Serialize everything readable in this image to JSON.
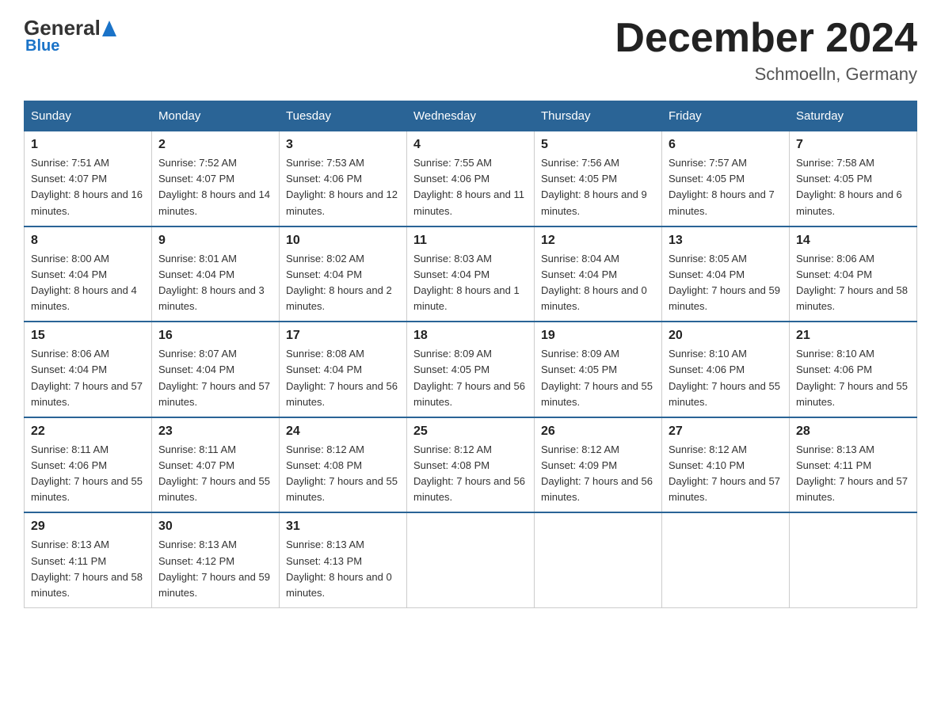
{
  "header": {
    "logo_general": "General",
    "logo_blue": "Blue",
    "month_title": "December 2024",
    "location": "Schmoelln, Germany"
  },
  "days_of_week": [
    "Sunday",
    "Monday",
    "Tuesday",
    "Wednesday",
    "Thursday",
    "Friday",
    "Saturday"
  ],
  "weeks": [
    [
      {
        "day": "1",
        "sunrise": "7:51 AM",
        "sunset": "4:07 PM",
        "daylight": "8 hours and 16 minutes."
      },
      {
        "day": "2",
        "sunrise": "7:52 AM",
        "sunset": "4:07 PM",
        "daylight": "8 hours and 14 minutes."
      },
      {
        "day": "3",
        "sunrise": "7:53 AM",
        "sunset": "4:06 PM",
        "daylight": "8 hours and 12 minutes."
      },
      {
        "day": "4",
        "sunrise": "7:55 AM",
        "sunset": "4:06 PM",
        "daylight": "8 hours and 11 minutes."
      },
      {
        "day": "5",
        "sunrise": "7:56 AM",
        "sunset": "4:05 PM",
        "daylight": "8 hours and 9 minutes."
      },
      {
        "day": "6",
        "sunrise": "7:57 AM",
        "sunset": "4:05 PM",
        "daylight": "8 hours and 7 minutes."
      },
      {
        "day": "7",
        "sunrise": "7:58 AM",
        "sunset": "4:05 PM",
        "daylight": "8 hours and 6 minutes."
      }
    ],
    [
      {
        "day": "8",
        "sunrise": "8:00 AM",
        "sunset": "4:04 PM",
        "daylight": "8 hours and 4 minutes."
      },
      {
        "day": "9",
        "sunrise": "8:01 AM",
        "sunset": "4:04 PM",
        "daylight": "8 hours and 3 minutes."
      },
      {
        "day": "10",
        "sunrise": "8:02 AM",
        "sunset": "4:04 PM",
        "daylight": "8 hours and 2 minutes."
      },
      {
        "day": "11",
        "sunrise": "8:03 AM",
        "sunset": "4:04 PM",
        "daylight": "8 hours and 1 minute."
      },
      {
        "day": "12",
        "sunrise": "8:04 AM",
        "sunset": "4:04 PM",
        "daylight": "8 hours and 0 minutes."
      },
      {
        "day": "13",
        "sunrise": "8:05 AM",
        "sunset": "4:04 PM",
        "daylight": "7 hours and 59 minutes."
      },
      {
        "day": "14",
        "sunrise": "8:06 AM",
        "sunset": "4:04 PM",
        "daylight": "7 hours and 58 minutes."
      }
    ],
    [
      {
        "day": "15",
        "sunrise": "8:06 AM",
        "sunset": "4:04 PM",
        "daylight": "7 hours and 57 minutes."
      },
      {
        "day": "16",
        "sunrise": "8:07 AM",
        "sunset": "4:04 PM",
        "daylight": "7 hours and 57 minutes."
      },
      {
        "day": "17",
        "sunrise": "8:08 AM",
        "sunset": "4:04 PM",
        "daylight": "7 hours and 56 minutes."
      },
      {
        "day": "18",
        "sunrise": "8:09 AM",
        "sunset": "4:05 PM",
        "daylight": "7 hours and 56 minutes."
      },
      {
        "day": "19",
        "sunrise": "8:09 AM",
        "sunset": "4:05 PM",
        "daylight": "7 hours and 55 minutes."
      },
      {
        "day": "20",
        "sunrise": "8:10 AM",
        "sunset": "4:06 PM",
        "daylight": "7 hours and 55 minutes."
      },
      {
        "day": "21",
        "sunrise": "8:10 AM",
        "sunset": "4:06 PM",
        "daylight": "7 hours and 55 minutes."
      }
    ],
    [
      {
        "day": "22",
        "sunrise": "8:11 AM",
        "sunset": "4:06 PM",
        "daylight": "7 hours and 55 minutes."
      },
      {
        "day": "23",
        "sunrise": "8:11 AM",
        "sunset": "4:07 PM",
        "daylight": "7 hours and 55 minutes."
      },
      {
        "day": "24",
        "sunrise": "8:12 AM",
        "sunset": "4:08 PM",
        "daylight": "7 hours and 55 minutes."
      },
      {
        "day": "25",
        "sunrise": "8:12 AM",
        "sunset": "4:08 PM",
        "daylight": "7 hours and 56 minutes."
      },
      {
        "day": "26",
        "sunrise": "8:12 AM",
        "sunset": "4:09 PM",
        "daylight": "7 hours and 56 minutes."
      },
      {
        "day": "27",
        "sunrise": "8:12 AM",
        "sunset": "4:10 PM",
        "daylight": "7 hours and 57 minutes."
      },
      {
        "day": "28",
        "sunrise": "8:13 AM",
        "sunset": "4:11 PM",
        "daylight": "7 hours and 57 minutes."
      }
    ],
    [
      {
        "day": "29",
        "sunrise": "8:13 AM",
        "sunset": "4:11 PM",
        "daylight": "7 hours and 58 minutes."
      },
      {
        "day": "30",
        "sunrise": "8:13 AM",
        "sunset": "4:12 PM",
        "daylight": "7 hours and 59 minutes."
      },
      {
        "day": "31",
        "sunrise": "8:13 AM",
        "sunset": "4:13 PM",
        "daylight": "8 hours and 0 minutes."
      },
      null,
      null,
      null,
      null
    ]
  ]
}
